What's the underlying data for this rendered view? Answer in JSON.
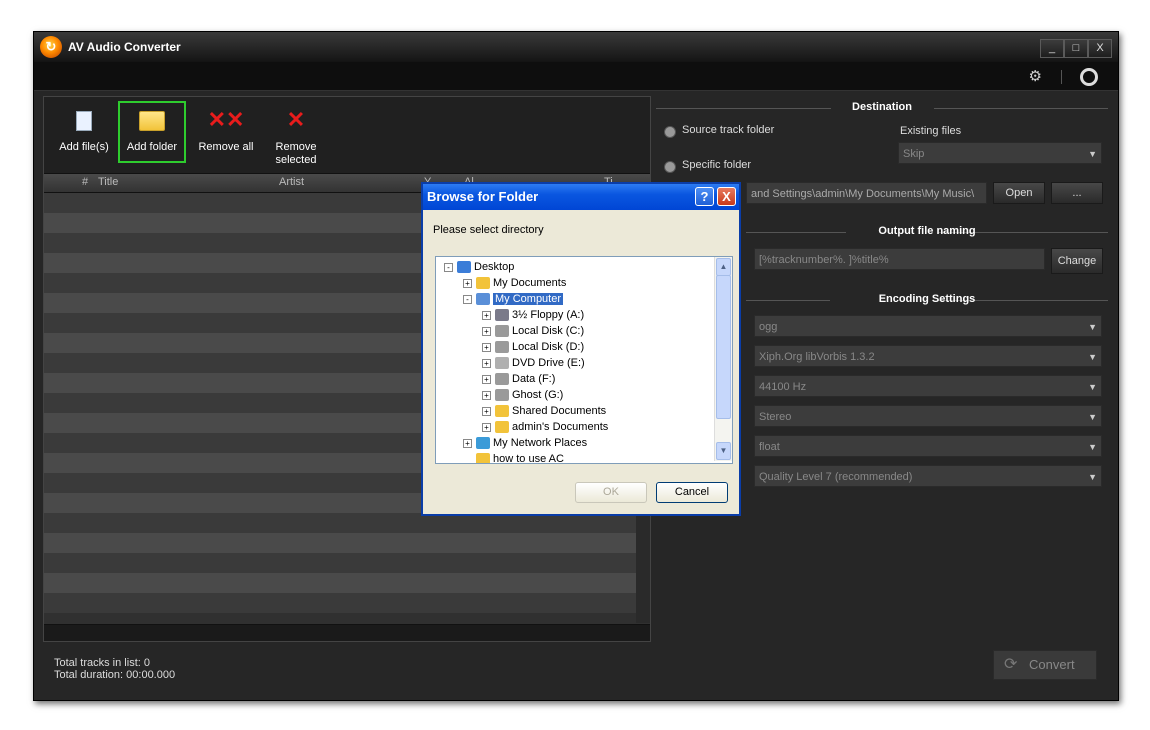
{
  "app": {
    "title": "AV Audio Converter",
    "window_controls": [
      "_",
      "□",
      "X"
    ]
  },
  "menubar": {
    "icons": [
      "gears-icon",
      "help-ring-icon"
    ]
  },
  "toolbar": {
    "add_files": "Add file(s)",
    "add_folder": "Add folder",
    "remove_all": "Remove all",
    "remove_selected_1": "Remove",
    "remove_selected_2": "selected"
  },
  "table": {
    "columns": [
      "#",
      "Title",
      "Artist",
      "Y...",
      "Al...",
      "Ti..."
    ]
  },
  "status": {
    "tracks": "Total tracks in list: 0",
    "duration": "Total duration: 00:00.000"
  },
  "destination": {
    "header": "Destination",
    "source_track_folder": "Source track folder",
    "specific_folder": "Specific folder",
    "existing_files_label": "Existing files",
    "existing_files_value": "Skip",
    "path": "and Settings\\admin\\My Documents\\My Music\\",
    "open_button": "Open",
    "browse_button": "..."
  },
  "output_naming": {
    "header": "Output file naming",
    "pattern": "[%tracknumber%. ]%title%",
    "change_button": "Change"
  },
  "encoding": {
    "header": "Encoding Settings",
    "format": "ogg",
    "codec": "Xiph.Org libVorbis 1.3.2",
    "sample_rate": "44100 Hz",
    "channels": "Stereo",
    "sample_format": "float",
    "quality": "Quality Level 7 (recommended)"
  },
  "convert_button": "Convert",
  "dialog": {
    "title": "Browse for Folder",
    "help": "?",
    "close": "X",
    "prompt": "Please select directory",
    "tree": [
      {
        "label": "Desktop",
        "icon": "desktop-icon",
        "pm": "-"
      },
      {
        "label": "My Documents",
        "icon": "documents-folder-icon",
        "pm": "+"
      },
      {
        "label": "My Computer",
        "icon": "computer-icon",
        "pm": "-",
        "selected": true
      },
      {
        "label": "3½ Floppy (A:)",
        "icon": "floppy-icon",
        "pm": "+"
      },
      {
        "label": "Local Disk (C:)",
        "icon": "hard-disk-icon",
        "pm": "+"
      },
      {
        "label": "Local Disk (D:)",
        "icon": "hard-disk-icon",
        "pm": "+"
      },
      {
        "label": "DVD Drive (E:)",
        "icon": "dvd-drive-icon",
        "pm": "+"
      },
      {
        "label": "Data (F:)",
        "icon": "hard-disk-icon",
        "pm": "+"
      },
      {
        "label": "Ghost (G:)",
        "icon": "hard-disk-icon",
        "pm": "+"
      },
      {
        "label": "Shared Documents",
        "icon": "folder-icon",
        "pm": "+"
      },
      {
        "label": "admin's Documents",
        "icon": "folder-icon",
        "pm": "+"
      },
      {
        "label": "My Network Places",
        "icon": "network-icon",
        "pm": "+"
      },
      {
        "label": "how to use AC",
        "icon": "folder-icon",
        "pm": ""
      }
    ],
    "ok": "OK",
    "cancel": "Cancel"
  }
}
